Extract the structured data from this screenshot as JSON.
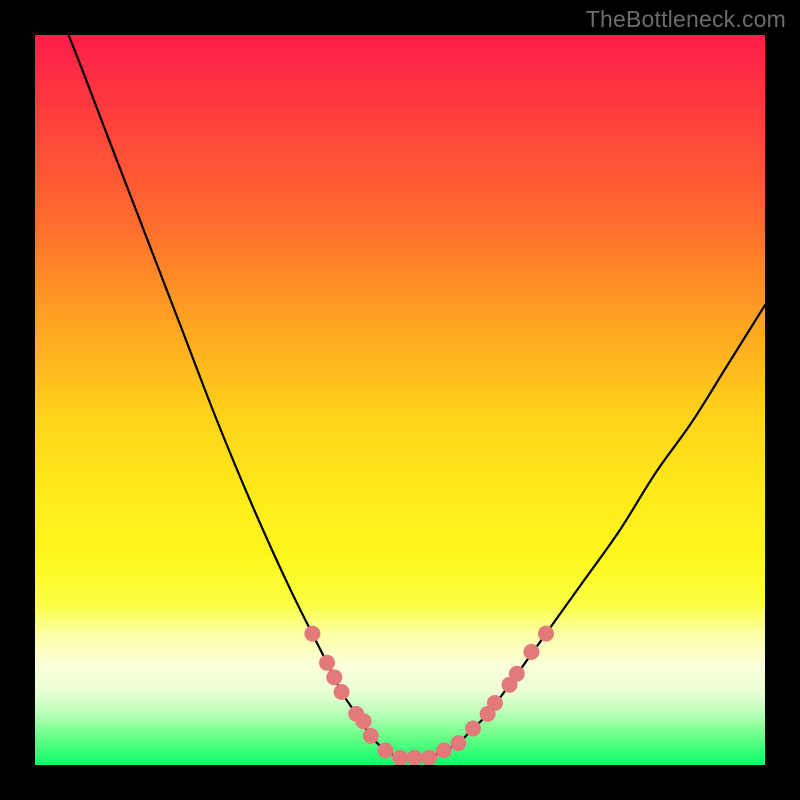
{
  "watermark": "TheBottleneck.com",
  "colors": {
    "background_black": "#000000",
    "curve_stroke": "#000000",
    "marker_fill": "#e27a7a",
    "gradient_top": "#ff1d4a",
    "gradient_mid": "#ffe91a",
    "gradient_bottom": "#0bff69"
  },
  "chart_data": {
    "type": "line",
    "title": "",
    "xlabel": "",
    "ylabel": "",
    "xlim": [
      0,
      100
    ],
    "ylim": [
      0,
      100
    ],
    "grid": false,
    "legend": false,
    "series": [
      {
        "name": "bottleneck-curve",
        "x": [
          0,
          5,
          10,
          15,
          20,
          25,
          30,
          35,
          40,
          42,
          44,
          46,
          48,
          50,
          52,
          54,
          56,
          58,
          60,
          62,
          65,
          70,
          75,
          80,
          85,
          90,
          95,
          100
        ],
        "values": [
          111,
          99,
          86,
          73,
          60,
          47,
          35,
          24,
          14,
          10,
          7,
          4,
          2,
          1,
          1,
          1,
          2,
          3,
          5,
          7,
          11,
          18,
          25,
          32,
          40,
          47,
          55,
          63
        ]
      }
    ],
    "markers": {
      "name": "highlighted-points",
      "x": [
        38,
        40,
        41,
        42,
        44,
        45,
        46,
        48,
        50,
        52,
        54,
        56,
        58,
        60,
        62,
        63,
        65,
        66,
        68,
        70
      ],
      "values": [
        18,
        14,
        12,
        10,
        7,
        6,
        4,
        2,
        1,
        1,
        1,
        2,
        3,
        5,
        7,
        8.5,
        11,
        12.5,
        15.5,
        18
      ]
    }
  }
}
